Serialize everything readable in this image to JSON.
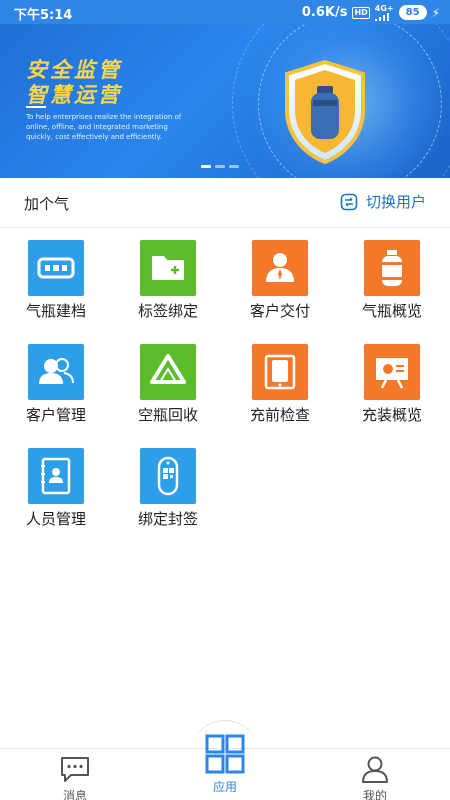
{
  "status_bar": {
    "time": "下午5:14",
    "speed": "0.6K/s",
    "hd": "HD",
    "network": "4G+",
    "battery": "85"
  },
  "banner": {
    "title_line1": "安全监管",
    "title_line2": "智慧运营",
    "subtitle": "To help enterprises realize the integration of online, offline, and integrated marketing quickly, cost effectively and efficiently.",
    "page_count": 3,
    "active_page": 1
  },
  "user": {
    "company": "加个气",
    "switch_label": "切换用户"
  },
  "apps": [
    {
      "label": "气瓶建档",
      "color": "blue",
      "icon": "cylinder-file-icon"
    },
    {
      "label": "标签绑定",
      "color": "green",
      "icon": "folder-plus-icon"
    },
    {
      "label": "客户交付",
      "color": "orange",
      "icon": "customer-icon"
    },
    {
      "label": "气瓶概览",
      "color": "orange",
      "icon": "gas-cylinder-icon"
    },
    {
      "label": "客户管理",
      "color": "blue",
      "icon": "users-icon"
    },
    {
      "label": "空瓶回收",
      "color": "green",
      "icon": "recycle-icon"
    },
    {
      "label": "充前检查",
      "color": "orange",
      "icon": "phone-check-icon"
    },
    {
      "label": "充装概览",
      "color": "orange",
      "icon": "presentation-icon"
    },
    {
      "label": "人员管理",
      "color": "blue",
      "icon": "contact-book-icon"
    },
    {
      "label": "绑定封签",
      "color": "blue",
      "icon": "qr-tag-icon"
    }
  ],
  "nav": {
    "messages": "消息",
    "apps": "应用",
    "mine": "我的",
    "active": "apps"
  },
  "colors": {
    "primary": "#2a86ec",
    "blue_icon": "#2d9ee8",
    "green_icon": "#5cbd2b",
    "orange_icon": "#f3782a"
  }
}
